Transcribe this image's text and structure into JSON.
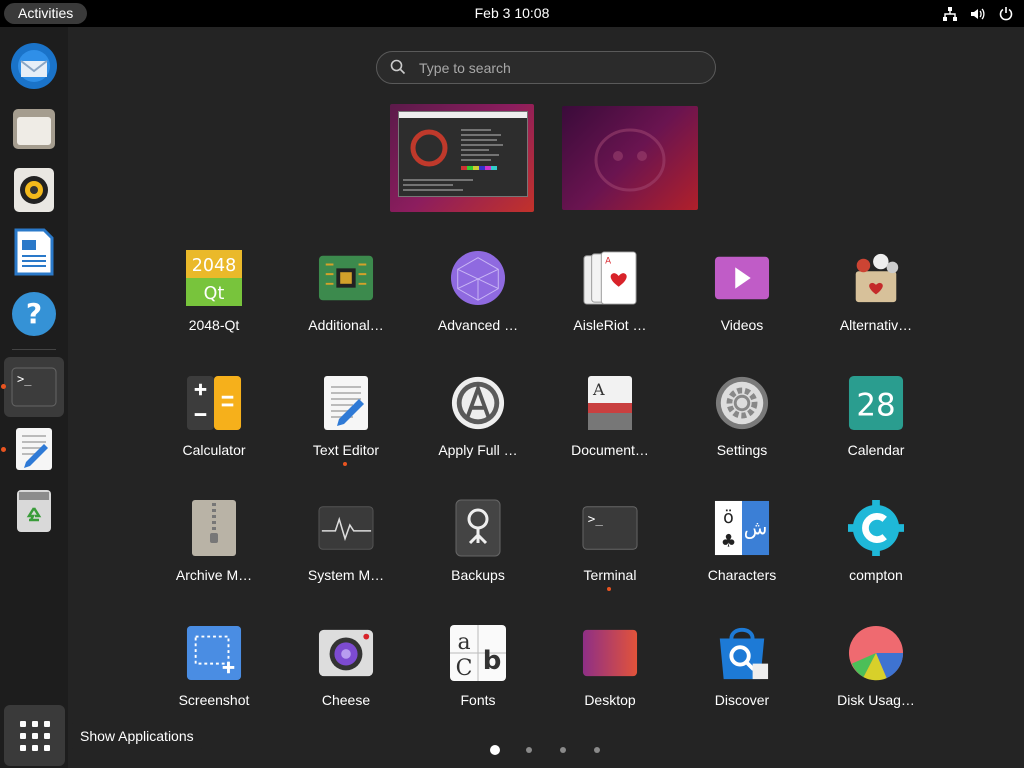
{
  "topbar": {
    "activities": "Activities",
    "clock": "Feb 3  10:08"
  },
  "tray_icons": [
    "network-icon",
    "volume-icon",
    "power-icon"
  ],
  "dock": {
    "items": [
      {
        "name": "thunderbird",
        "icon": "mail-icon"
      },
      {
        "name": "files",
        "icon": "folder-icon"
      },
      {
        "name": "rhythmbox",
        "icon": "speaker-icon"
      },
      {
        "name": "libreoffice-writer",
        "icon": "document-icon"
      },
      {
        "name": "help",
        "icon": "help-icon"
      },
      {
        "name": "terminal",
        "icon": "terminal-icon",
        "active": true,
        "running": true
      },
      {
        "name": "text-editor",
        "icon": "text-editor-icon",
        "running": true
      },
      {
        "name": "trash",
        "icon": "trash-icon"
      }
    ],
    "show_apps_tooltip": "Show Applications"
  },
  "search": {
    "placeholder": "Type to search"
  },
  "apps": [
    {
      "label": "2048-Qt",
      "icon": "2048-icon",
      "running": false
    },
    {
      "label": "Additional…",
      "icon": "chip-icon",
      "running": false
    },
    {
      "label": "Advanced …",
      "icon": "advanced-network-icon",
      "running": false
    },
    {
      "label": "AisleRiot …",
      "icon": "cards-icon",
      "running": false
    },
    {
      "label": "Videos",
      "icon": "video-icon",
      "running": false
    },
    {
      "label": "Alternativ…",
      "icon": "alternatives-icon",
      "running": false
    },
    {
      "label": "Calculator",
      "icon": "calculator-icon",
      "running": false
    },
    {
      "label": "Text Editor",
      "icon": "text-editor-icon",
      "running": true
    },
    {
      "label": "Apply Full …",
      "icon": "apply-icon",
      "running": false
    },
    {
      "label": "Document…",
      "icon": "document-viewer-icon",
      "running": false
    },
    {
      "label": "Settings",
      "icon": "settings-icon",
      "running": false
    },
    {
      "label": "Calendar",
      "icon": "calendar-icon",
      "running": false,
      "text": "28"
    },
    {
      "label": "Archive M…",
      "icon": "archive-icon",
      "running": false
    },
    {
      "label": "System M…",
      "icon": "system-monitor-icon",
      "running": false
    },
    {
      "label": "Backups",
      "icon": "backups-icon",
      "running": false
    },
    {
      "label": "Terminal",
      "icon": "terminal-icon",
      "running": true
    },
    {
      "label": "Characters",
      "icon": "characters-icon",
      "running": false
    },
    {
      "label": "compton",
      "icon": "compton-icon",
      "running": false
    },
    {
      "label": "Screenshot",
      "icon": "screenshot-icon",
      "running": false
    },
    {
      "label": "Cheese",
      "icon": "camera-icon",
      "running": false
    },
    {
      "label": "Fonts",
      "icon": "fonts-icon",
      "running": false
    },
    {
      "label": "Desktop",
      "icon": "desktop-icon",
      "running": false
    },
    {
      "label": "Discover",
      "icon": "discover-icon",
      "running": false
    },
    {
      "label": "Disk Usag…",
      "icon": "pie-icon",
      "running": false
    }
  ],
  "tile_text": {
    "2048": "2048",
    "qt": "Qt",
    "characters_o": "ö",
    "characters_ar": "ش",
    "fonts_a": "a",
    "fonts_b": "b",
    "fonts_c": "C",
    "doc_a": "A"
  },
  "pagination": {
    "pages": 4,
    "current": 1
  },
  "colors": {
    "accent": "#e95420",
    "background": "#242424",
    "panel": "#000000"
  }
}
